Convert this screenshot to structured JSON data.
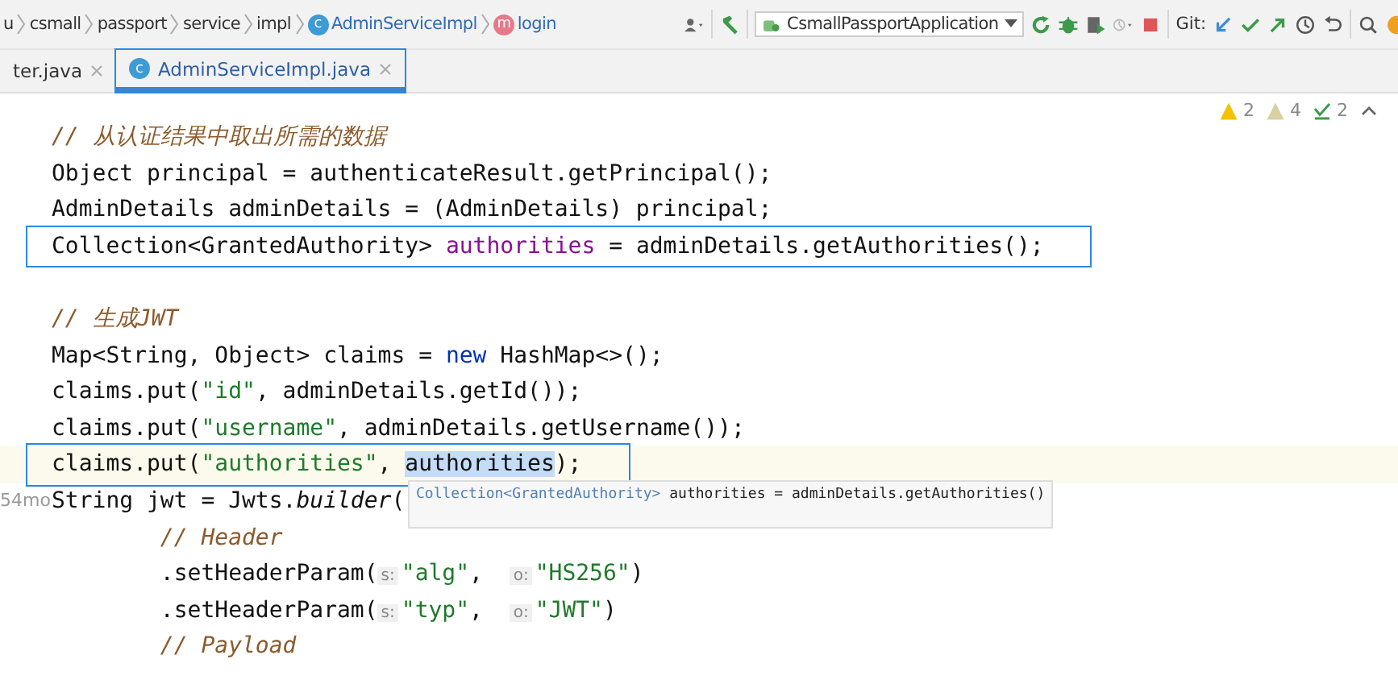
{
  "breadcrumbs": [
    {
      "label": "u",
      "kind": "plain"
    },
    {
      "label": "csmall",
      "kind": "plain"
    },
    {
      "label": "passport",
      "kind": "plain"
    },
    {
      "label": "service",
      "kind": "plain"
    },
    {
      "label": "impl",
      "kind": "plain"
    },
    {
      "label": "AdminServiceImpl",
      "kind": "class",
      "badge": "c"
    },
    {
      "label": "login",
      "kind": "method",
      "badge": "m"
    }
  ],
  "run_config": {
    "label": "CsmallPassportApplication"
  },
  "git_label": "Git:",
  "tabs": [
    {
      "label": "ter.java",
      "selected": false,
      "annotated": false
    },
    {
      "label": "AdminServiceImpl.java",
      "selected": true,
      "annotated": true,
      "badge": "c"
    }
  ],
  "inspections": [
    {
      "kind": "warning",
      "count": "2"
    },
    {
      "kind": "weak",
      "count": "4"
    },
    {
      "kind": "typo",
      "count": "2"
    }
  ],
  "code": [
    {
      "current": false,
      "annotated": false,
      "tokens": [
        {
          "kind": "comment",
          "text": "// 从认证结果中取出所需的数据"
        }
      ]
    },
    {
      "current": false,
      "annotated": false,
      "tokens": [
        {
          "kind": "text",
          "text": "Object principal = authenticateResult.getPrincipal();"
        }
      ]
    },
    {
      "current": false,
      "annotated": false,
      "tokens": [
        {
          "kind": "text",
          "text": "AdminDetails adminDetails = (AdminDetails) principal;"
        }
      ]
    },
    {
      "current": false,
      "annotated": true,
      "tokens": [
        {
          "kind": "text",
          "text": "Collection<GrantedAuthority> "
        },
        {
          "kind": "var",
          "text": "authorities"
        },
        {
          "kind": "text",
          "text": " = adminDetails.getAuthorities();"
        }
      ]
    },
    {
      "current": false,
      "annotated": false
    },
    {
      "current": false,
      "annotated": false,
      "tokens": [
        {
          "kind": "comment",
          "text": "// 生成JWT"
        }
      ]
    },
    {
      "current": false,
      "annotated": false,
      "tokens": [
        {
          "kind": "text",
          "text": "Map<String, Object> claims = "
        },
        {
          "kind": "keyword",
          "text": "new"
        },
        {
          "kind": "text",
          "text": " HashMap<>();"
        }
      ]
    },
    {
      "current": false,
      "annotated": false,
      "tokens": [
        {
          "kind": "text",
          "text": "claims.put("
        },
        {
          "kind": "string",
          "text": "\"id\""
        },
        {
          "kind": "text",
          "text": ", adminDetails.getId());"
        }
      ]
    },
    {
      "current": false,
      "annotated": false,
      "tokens": [
        {
          "kind": "text",
          "text": "claims.put("
        },
        {
          "kind": "string",
          "text": "\"username\""
        },
        {
          "kind": "text",
          "text": ", adminDetails.getUsername());"
        }
      ]
    },
    {
      "current": true,
      "annotated": true,
      "tokens": [
        {
          "kind": "text",
          "text": "claims.put("
        },
        {
          "kind": "string",
          "text": "\"authorities\""
        },
        {
          "kind": "text",
          "text": ", "
        },
        {
          "kind": "selected",
          "text": "authorities"
        },
        {
          "kind": "text",
          "text": ");"
        }
      ]
    },
    {
      "current": false,
      "annotated": false,
      "gutter": "54mo",
      "tokens": [
        {
          "kind": "text",
          "text": "String jwt = Jwts."
        },
        {
          "kind": "static",
          "text": "builder"
        },
        {
          "kind": "text",
          "text": "("
        }
      ]
    },
    {
      "current": false,
      "annotated": false,
      "tokens": [
        {
          "kind": "comment",
          "text": "        // Header"
        }
      ]
    },
    {
      "current": false,
      "annotated": false,
      "tokens": [
        {
          "kind": "text",
          "text": "        .setHeaderParam("
        },
        {
          "kind": "hint",
          "text": "s:"
        },
        {
          "kind": "string",
          "text": "\"alg\""
        },
        {
          "kind": "text",
          "text": ",  "
        },
        {
          "kind": "hint",
          "text": "o:"
        },
        {
          "kind": "string",
          "text": "\"HS256\""
        },
        {
          "kind": "text",
          "text": ")"
        }
      ]
    },
    {
      "current": false,
      "annotated": false,
      "tokens": [
        {
          "kind": "text",
          "text": "        .setHeaderParam("
        },
        {
          "kind": "hint",
          "text": "s:"
        },
        {
          "kind": "string",
          "text": "\"typ\""
        },
        {
          "kind": "text",
          "text": ",  "
        },
        {
          "kind": "hint",
          "text": "o:"
        },
        {
          "kind": "string",
          "text": "\"JWT\""
        },
        {
          "kind": "text",
          "text": ")"
        }
      ]
    },
    {
      "current": false,
      "annotated": false,
      "tokens": [
        {
          "kind": "comment",
          "text": "        // Payload"
        }
      ]
    }
  ],
  "tooltip": {
    "type_text": "Collection<GrantedAuthority>",
    "rest": "authorities = adminDetails.getAuthorities()"
  }
}
